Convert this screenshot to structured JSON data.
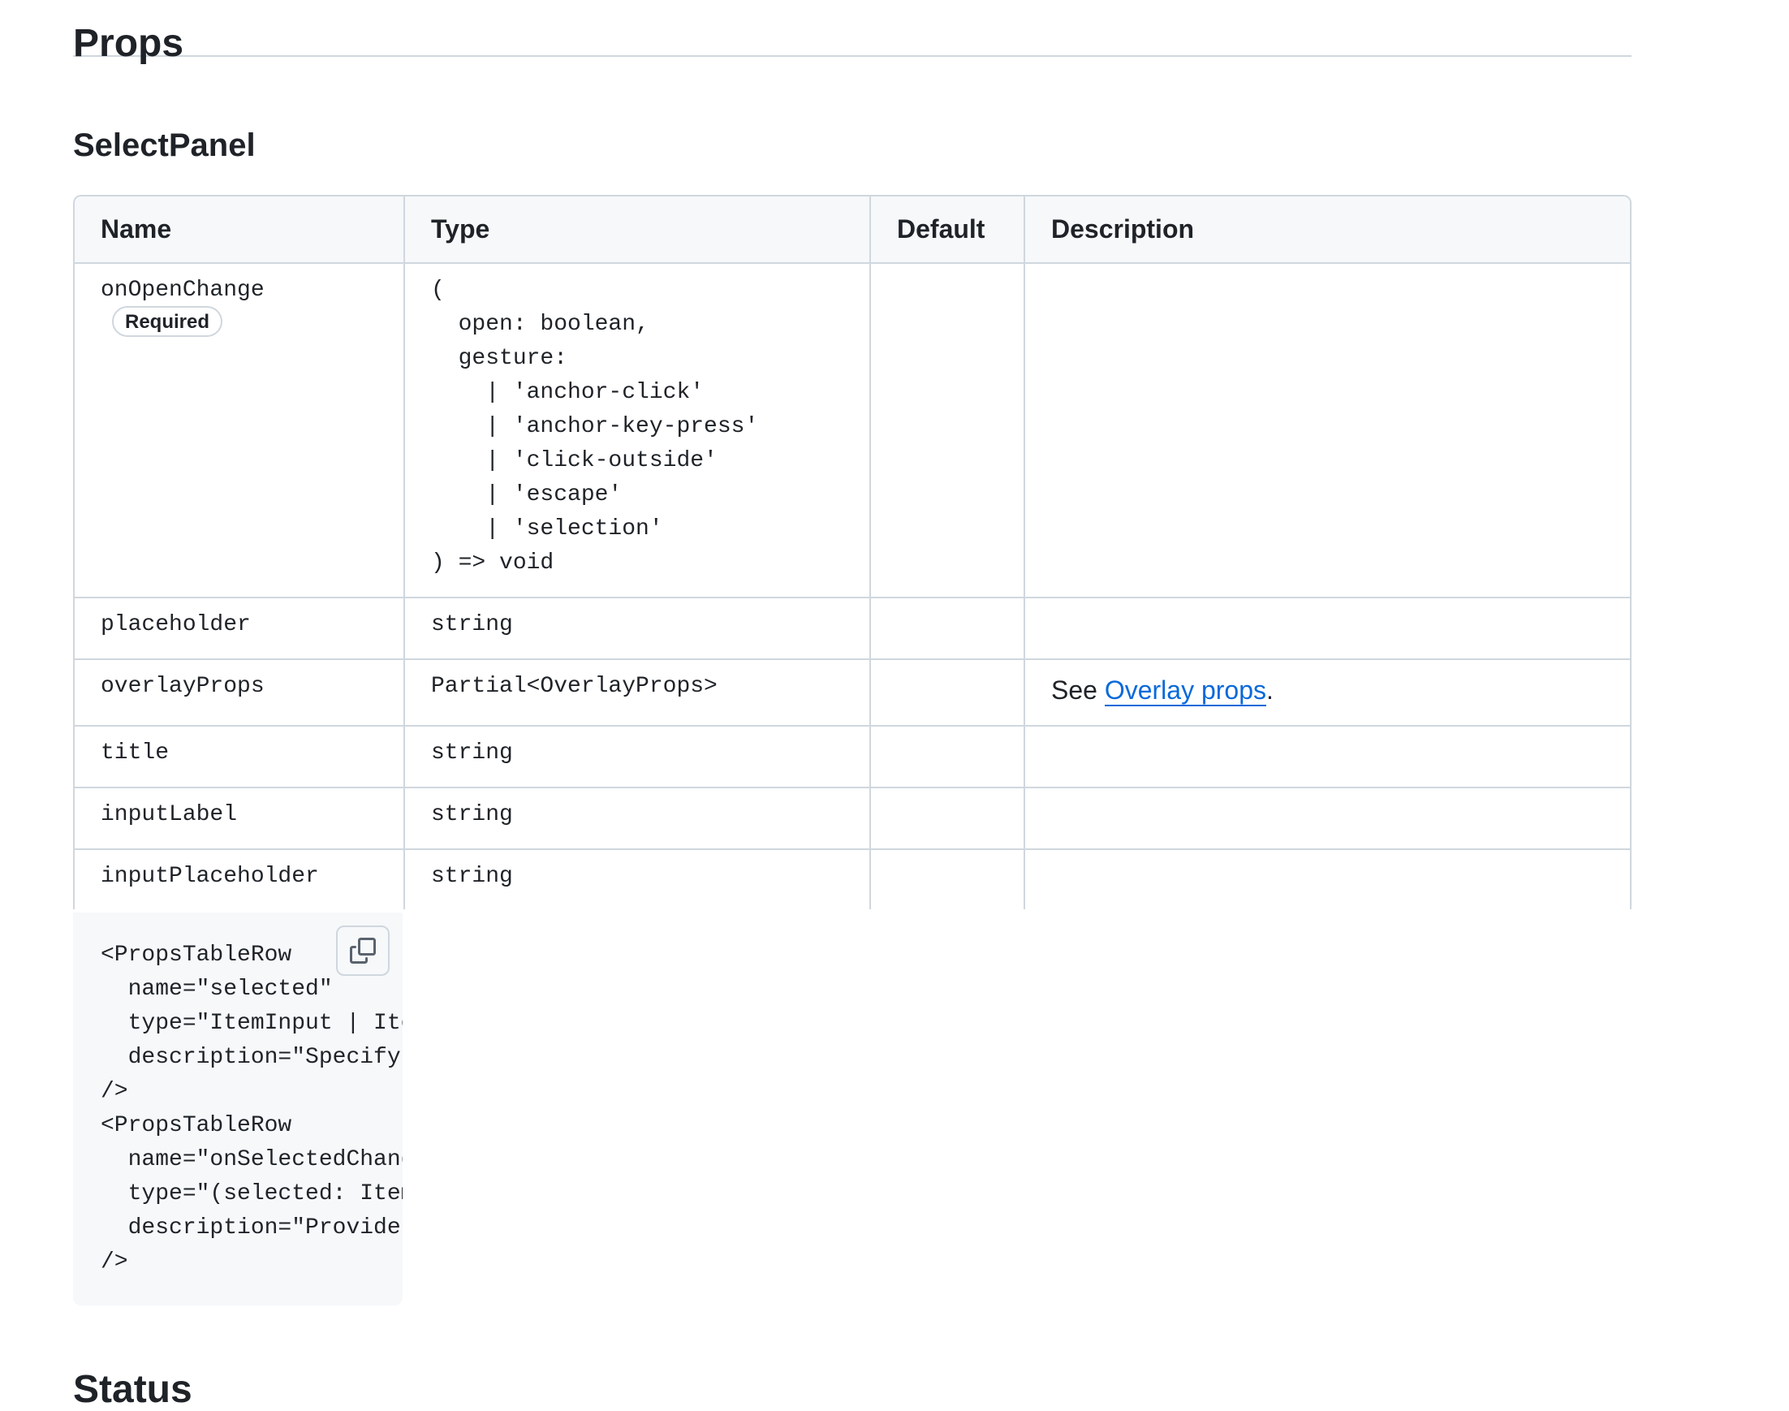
{
  "page": {
    "title": "Props",
    "section_title": "SelectPanel",
    "next_heading": "Status"
  },
  "table": {
    "headers": {
      "name": "Name",
      "type": "Type",
      "default": "Default",
      "description": "Description"
    },
    "rows": [
      {
        "name": "onOpenChange",
        "badge": "Required",
        "type": "(\n  open: boolean,\n  gesture:\n    | 'anchor-click'\n    | 'anchor-key-press'\n    | 'click-outside'\n    | 'escape'\n    | 'selection'\n) => void",
        "default": "",
        "description": ""
      },
      {
        "name": "placeholder",
        "type": "string",
        "default": "",
        "description": ""
      },
      {
        "name": "overlayProps",
        "type": "Partial<OverlayProps>",
        "default": "",
        "description_prefix": "See ",
        "description_link": "Overlay props",
        "description_suffix": "."
      },
      {
        "name": "title",
        "type": "string",
        "default": "",
        "description": ""
      },
      {
        "name": "inputLabel",
        "type": "string",
        "default": "",
        "description": ""
      },
      {
        "name": "inputPlaceholder",
        "type": "string",
        "default": "",
        "description": ""
      }
    ]
  },
  "code_block": {
    "code": "<PropsTableRow\n  name=\"selected\"\n  type=\"ItemInput | Item\n  description=\"Specify t\n/>\n<PropsTableRow\n  name=\"onSelectedChange\n  type=\"(selected: ItemI\n  description=\"Provide a\n/>",
    "copy_icon": "copy-icon"
  },
  "colors": {
    "text": "#1f2328",
    "border": "#d0d7de",
    "header_bg": "#f6f8fa",
    "link": "#0969da"
  }
}
